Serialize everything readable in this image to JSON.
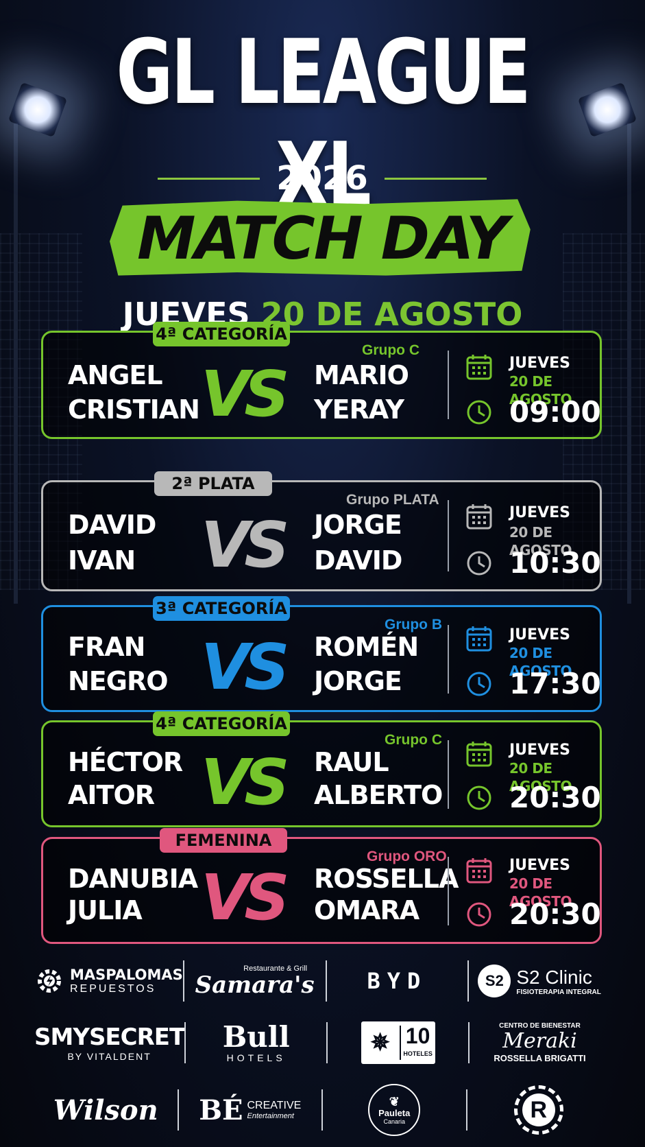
{
  "header": {
    "title": "GL LEAGUE XL",
    "year": "2026",
    "subtitle": "MATCH DAY",
    "day_label": "JUEVES",
    "date_label": "20 DE AGOSTO"
  },
  "colors": {
    "green": "#76c52c",
    "silver": "#b8b8b8",
    "blue": "#1f8fe0",
    "pink": "#e0577e"
  },
  "matches": [
    {
      "category": "4ª CATEGORÍA",
      "group": "Grupo C",
      "team_a": [
        "ANGEL",
        "CRISTIAN"
      ],
      "vs": "VS",
      "team_b": [
        "MARIO",
        "YERAY"
      ],
      "day": "JUEVES",
      "date": "20 DE AGOSTO",
      "time": "09:00"
    },
    {
      "category": "2ª PLATA",
      "group": "Grupo PLATA",
      "team_a": [
        "DAVID",
        "IVAN"
      ],
      "vs": "VS",
      "team_b": [
        "JORGE",
        "DAVID"
      ],
      "day": "JUEVES",
      "date": "20 DE AGOSTO",
      "time": "10:30"
    },
    {
      "category": "3ª CATEGORÍA",
      "group": "Grupo B",
      "team_a": [
        "FRAN",
        "NEGRO"
      ],
      "vs": "VS",
      "team_b": [
        "ROMÉN",
        "JORGE"
      ],
      "day": "JUEVES",
      "date": "20 DE AGOSTO",
      "time": "17:30"
    },
    {
      "category": "4ª CATEGORÍA",
      "group": "Grupo C",
      "team_a": [
        "HÉCTOR",
        "AITOR"
      ],
      "vs": "VS",
      "team_b": [
        "RAUL",
        "ALBERTO"
      ],
      "day": "JUEVES",
      "date": "20 DE AGOSTO",
      "time": "20:30"
    },
    {
      "category": "FEMENINA",
      "group": "Grupo ORO",
      "team_a": [
        "DANUBIA",
        "JULIA"
      ],
      "vs": "VS",
      "team_b": [
        "ROSSELLA",
        "OMARA"
      ],
      "day": "JUEVES",
      "date": "20 DE AGOSTO",
      "time": "20:30"
    }
  ],
  "sponsors": {
    "row1": [
      {
        "name": "MASPALOMAS",
        "sub": "REPUESTOS"
      },
      {
        "top": "Restaurante & Grill",
        "name": "Samara's"
      },
      {
        "name": "BYD"
      },
      {
        "badge": "S2",
        "name": "S2 Clinic",
        "sub": "FISIOTERAPIA INTEGRAL"
      }
    ],
    "row2": [
      {
        "name": "SMYSECRET",
        "sub": "BY VITALDENT"
      },
      {
        "name": "Bull",
        "sub": "HOTELS"
      },
      {
        "name": "10",
        "sub": "HOTELES"
      },
      {
        "top": "CENTRO DE BIENESTAR",
        "name": "Meraki",
        "sub": "ROSSELLA BRIGATTI"
      }
    ],
    "row3": [
      {
        "name": "Wilson"
      },
      {
        "name": "BÉ",
        "tag": "CREATIVE",
        "sub": "Entertainment"
      },
      {
        "name": "Pauleta",
        "sub": "Canaria"
      },
      {
        "name": "R"
      }
    ]
  }
}
